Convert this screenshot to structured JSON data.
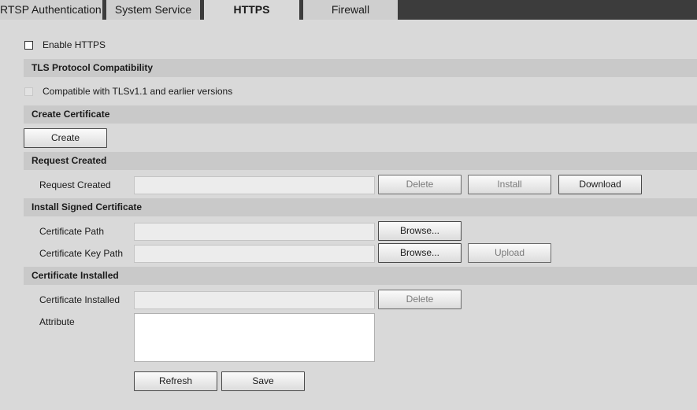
{
  "tabs": [
    {
      "label": "RTSP Authentication",
      "active": false
    },
    {
      "label": "System Service",
      "active": false
    },
    {
      "label": "HTTPS",
      "active": true
    },
    {
      "label": "Firewall",
      "active": false
    }
  ],
  "enable_https": {
    "label": "Enable HTTPS",
    "checked": false
  },
  "tls": {
    "title": "TLS Protocol Compatibility",
    "compat_label": "Compatible with TLSv1.1 and earlier versions",
    "compat_checked": false,
    "compat_enabled": false
  },
  "create_certificate": {
    "title": "Create Certificate",
    "create_button": "Create"
  },
  "request_created": {
    "title": "Request Created",
    "field_label": "Request Created",
    "value": "",
    "delete_button": "Delete",
    "install_button": "Install",
    "download_button": "Download"
  },
  "install_signed": {
    "title": "Install Signed Certificate",
    "cert_path_label": "Certificate Path",
    "cert_path_value": "",
    "cert_key_path_label": "Certificate Key Path",
    "cert_key_path_value": "",
    "browse_button": "Browse...",
    "upload_button": "Upload"
  },
  "cert_installed": {
    "title": "Certificate Installed",
    "field_label": "Certificate Installed",
    "value": "",
    "delete_button": "Delete",
    "attribute_label": "Attribute",
    "attribute_value": ""
  },
  "footer": {
    "refresh_button": "Refresh",
    "save_button": "Save"
  }
}
